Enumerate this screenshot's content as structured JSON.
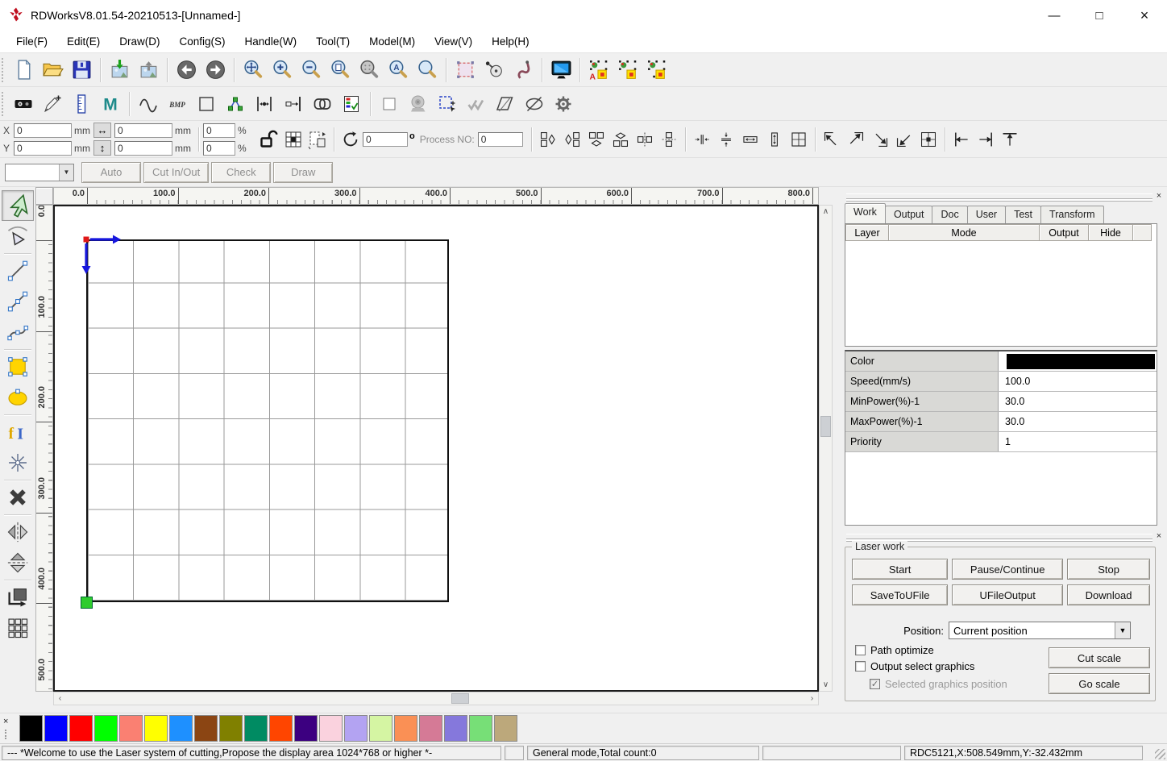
{
  "window": {
    "title": "RDWorksV8.01.54-20210513-[Unnamed-]",
    "minimize": "—",
    "maximize": "□",
    "close": "×"
  },
  "menu": {
    "items": [
      "File(F)",
      "Edit(E)",
      "Draw(D)",
      "Config(S)",
      "Handle(W)",
      "Tool(T)",
      "Model(M)",
      "View(V)",
      "Help(H)"
    ]
  },
  "toolbar_main": {
    "icons": [
      "new-file",
      "open-file",
      "save-file",
      "|",
      "import",
      "export",
      "|",
      "undo",
      "redo",
      "|",
      "zoom-pan",
      "zoom-in",
      "zoom-out",
      "zoom-page",
      "zoom-all",
      "zoom-select",
      "zoom-view",
      "|",
      "select-frame",
      "rotate-edit",
      "pick-hook",
      "|",
      "preview-monitor",
      "|",
      "mark-text",
      "mark-rect",
      "mark-point"
    ]
  },
  "toolbar_edit": {
    "icons": [
      "device",
      "pen-add",
      "ruler",
      "material-m",
      "|",
      "curve",
      "bmp",
      "rect-outline",
      "node-graph",
      "h-distribute",
      "right-distribute",
      "weld",
      "layer-list",
      "|",
      "small-checkbox",
      "camera",
      "marquee-add",
      "double-check",
      "skew",
      "ellipse-slash",
      "gear"
    ]
  },
  "coord_bar": {
    "x_label": "X",
    "y_label": "Y",
    "x_value": "0",
    "y_value": "0",
    "w_value": "0",
    "h_value": "0",
    "wp_value": "0",
    "hp_value": "0",
    "unit": "mm",
    "percent": "%",
    "angle_value": "0",
    "degree_unit": "o",
    "process_label": "Process NO:",
    "process_value": "0",
    "icons": [
      "lock-open",
      "grid-cell",
      "page-rel"
    ],
    "rotate_icon": "rotate-circle",
    "align_icons": [
      "flip-left",
      "flip-right",
      "flip-top",
      "flip-bottom",
      "mirror-across-h",
      "mirror-across-v",
      "|",
      "h-compress",
      "v-compress",
      "same-width",
      "same-height",
      "same-size",
      "|",
      "to-top-left",
      "to-top-right",
      "to-bottom-right",
      "to-bottom-left",
      "to-center",
      "|",
      "dock-left",
      "dock-right",
      "dock-top"
    ]
  },
  "anchor_bar": {
    "buttons": [
      "Auto",
      "Cut In/Out",
      "Check",
      "Draw"
    ]
  },
  "left_tools": {
    "icons": [
      "select",
      "node-edit",
      "|",
      "line",
      "polyline",
      "bezier",
      "|",
      "rect-tool",
      "ellipse-tool",
      "|",
      "text-tool",
      "point-tool",
      "|",
      "delete",
      "|",
      "mirror-h",
      "mirror-v",
      "|",
      "rotate-block",
      "array-copy"
    ]
  },
  "rulers": {
    "h_labels": [
      "0.0",
      "100.0",
      "200.0",
      "300.0",
      "400.0",
      "500.0",
      "600.0",
      "700.0",
      "800.0"
    ],
    "v_labels": [
      "0.0",
      "100.0",
      "200.0",
      "300.0",
      "400.0",
      "500.0"
    ]
  },
  "right_panel": {
    "tabs": [
      {
        "label": "Work",
        "active": true
      },
      {
        "label": "Output",
        "active": false
      },
      {
        "label": "Doc",
        "active": false
      },
      {
        "label": "User",
        "active": false
      },
      {
        "label": "Test",
        "active": false
      },
      {
        "label": "Transform",
        "active": false
      }
    ],
    "layer_table": {
      "headers": [
        "Layer",
        "Mode",
        "Output",
        "Hide",
        ""
      ]
    },
    "properties": {
      "rows": [
        {
          "label": "Color",
          "value": "",
          "swatch": "#000000"
        },
        {
          "label": "Speed(mm/s)",
          "value": "100.0"
        },
        {
          "label": "MinPower(%)-1",
          "value": "30.0"
        },
        {
          "label": "MaxPower(%)-1",
          "value": "30.0"
        },
        {
          "label": "Priority",
          "value": "1"
        }
      ]
    },
    "laser_work": {
      "title": "Laser work",
      "start": "Start",
      "pause": "Pause/Continue",
      "stop": "Stop",
      "save": "SaveToUFile",
      "ufile": "UFileOutput",
      "download": "Download",
      "position_label": "Position:",
      "position_value": "Current position",
      "checkboxes": [
        {
          "label": "Path optimize",
          "checked": false,
          "disabled": false
        },
        {
          "label": "Output select graphics",
          "checked": false,
          "disabled": false
        },
        {
          "label": "Selected graphics position",
          "checked": true,
          "disabled": true
        }
      ],
      "cut_scale": "Cut scale",
      "go_scale": "Go scale"
    }
  },
  "palette": {
    "colors": [
      "#000000",
      "#0000FF",
      "#FF0000",
      "#00FF00",
      "#FA8072",
      "#FFFF00",
      "#1E90FF",
      "#8B4513",
      "#808000",
      "#008B62",
      "#FF4500",
      "#3C0080",
      "#FAD2DE",
      "#B3A3F2",
      "#D5F5A3",
      "#FA9055",
      "#D57A96",
      "#8578DC",
      "#77DF77",
      "#BCA87B"
    ]
  },
  "statusbar": {
    "message": "--- *Welcome to use the Laser system of cutting,Propose the display area 1024*768 or higher *-",
    "mode": "General mode,Total count:0",
    "device": "RDC5121,X:508.549mm,Y:-32.432mm"
  }
}
